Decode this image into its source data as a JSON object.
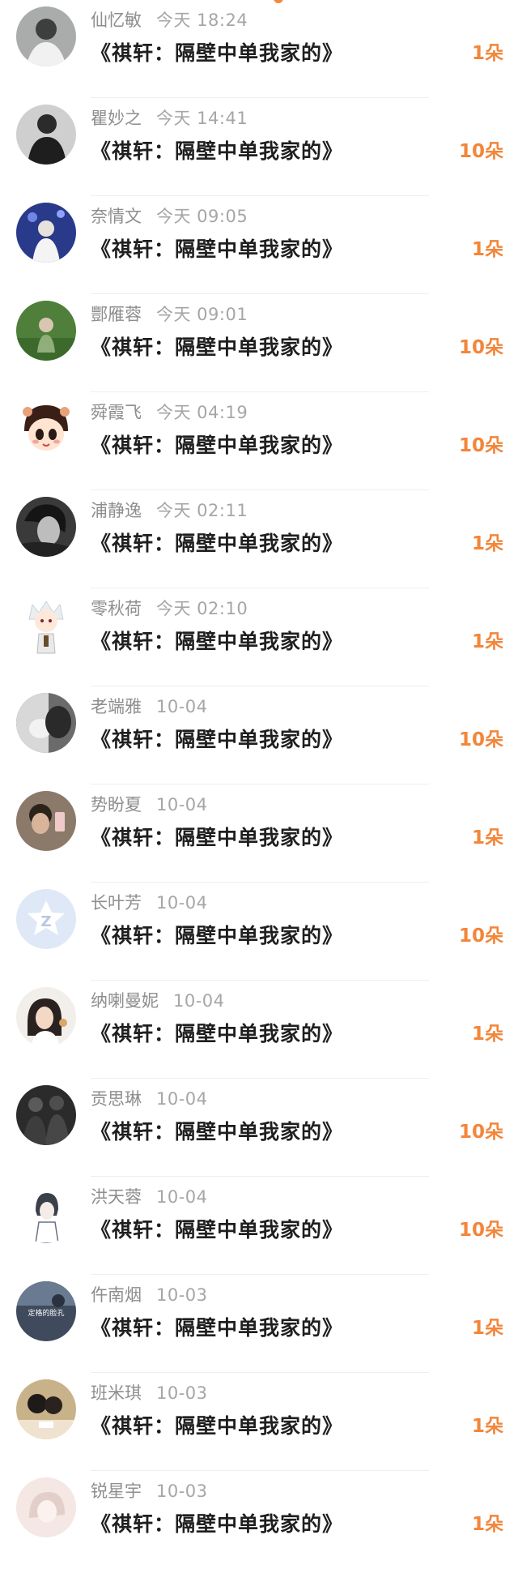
{
  "accent_color": "#f2863a",
  "records": [
    {
      "name": "仙忆敏",
      "time": "今天 18:24",
      "title": "《祺轩：隔壁中单我家的》",
      "count": "1朵",
      "avatar": "gray"
    },
    {
      "name": "瞿妙之",
      "time": "今天 14:41",
      "title": "《祺轩：隔壁中单我家的》",
      "count": "10朵",
      "avatar": "dark"
    },
    {
      "name": "奈情文",
      "time": "今天 09:05",
      "title": "《祺轩：隔壁中单我家的》",
      "count": "1朵",
      "avatar": "blue"
    },
    {
      "name": "酆雁蓉",
      "time": "今天 09:01",
      "title": "《祺轩：隔壁中单我家的》",
      "count": "10朵",
      "avatar": "green"
    },
    {
      "name": "舜霞飞",
      "time": "今天 04:19",
      "title": "《祺轩：隔壁中单我家的》",
      "count": "10朵",
      "avatar": "cartoon"
    },
    {
      "name": "浦静逸",
      "time": "今天 02:11",
      "title": "《祺轩：隔壁中单我家的》",
      "count": "1朵",
      "avatar": "bw"
    },
    {
      "name": "零秋荷",
      "time": "今天 02:10",
      "title": "《祺轩：隔壁中单我家的》",
      "count": "1朵",
      "avatar": "chibi"
    },
    {
      "name": "老端雅",
      "time": "10-04",
      "title": "《祺轩：隔壁中单我家的》",
      "count": "10朵",
      "avatar": "cat"
    },
    {
      "name": "势盼夏",
      "time": "10-04",
      "title": "《祺轩：隔壁中单我家的》",
      "count": "1朵",
      "avatar": "selfie"
    },
    {
      "name": "长叶芳",
      "time": "10-04",
      "title": "《祺轩：隔壁中单我家的》",
      "count": "10朵",
      "avatar": "default"
    },
    {
      "name": "纳喇曼妮",
      "time": "10-04",
      "title": "《祺轩：隔壁中单我家的》",
      "count": "1朵",
      "avatar": "girl"
    },
    {
      "name": "贡思琳",
      "time": "10-04",
      "title": "《祺轩：隔壁中单我家的》",
      "count": "10朵",
      "avatar": "soldiers"
    },
    {
      "name": "洪天蓉",
      "time": "10-04",
      "title": "《祺轩：隔壁中单我家的》",
      "count": "10朵",
      "avatar": "sketch"
    },
    {
      "name": "仵南烟",
      "time": "10-03",
      "title": "《祺轩：隔壁中单我家的》",
      "count": "1朵",
      "avatar": "text",
      "avatar_text": "定格的脸孔"
    },
    {
      "name": "班米琪",
      "time": "10-03",
      "title": "《祺轩：隔壁中单我家的》",
      "count": "1朵",
      "avatar": "couple"
    },
    {
      "name": "锐星宇",
      "time": "10-03",
      "title": "《祺轩：隔壁中单我家的》",
      "count": "1朵",
      "avatar": "pale"
    }
  ]
}
